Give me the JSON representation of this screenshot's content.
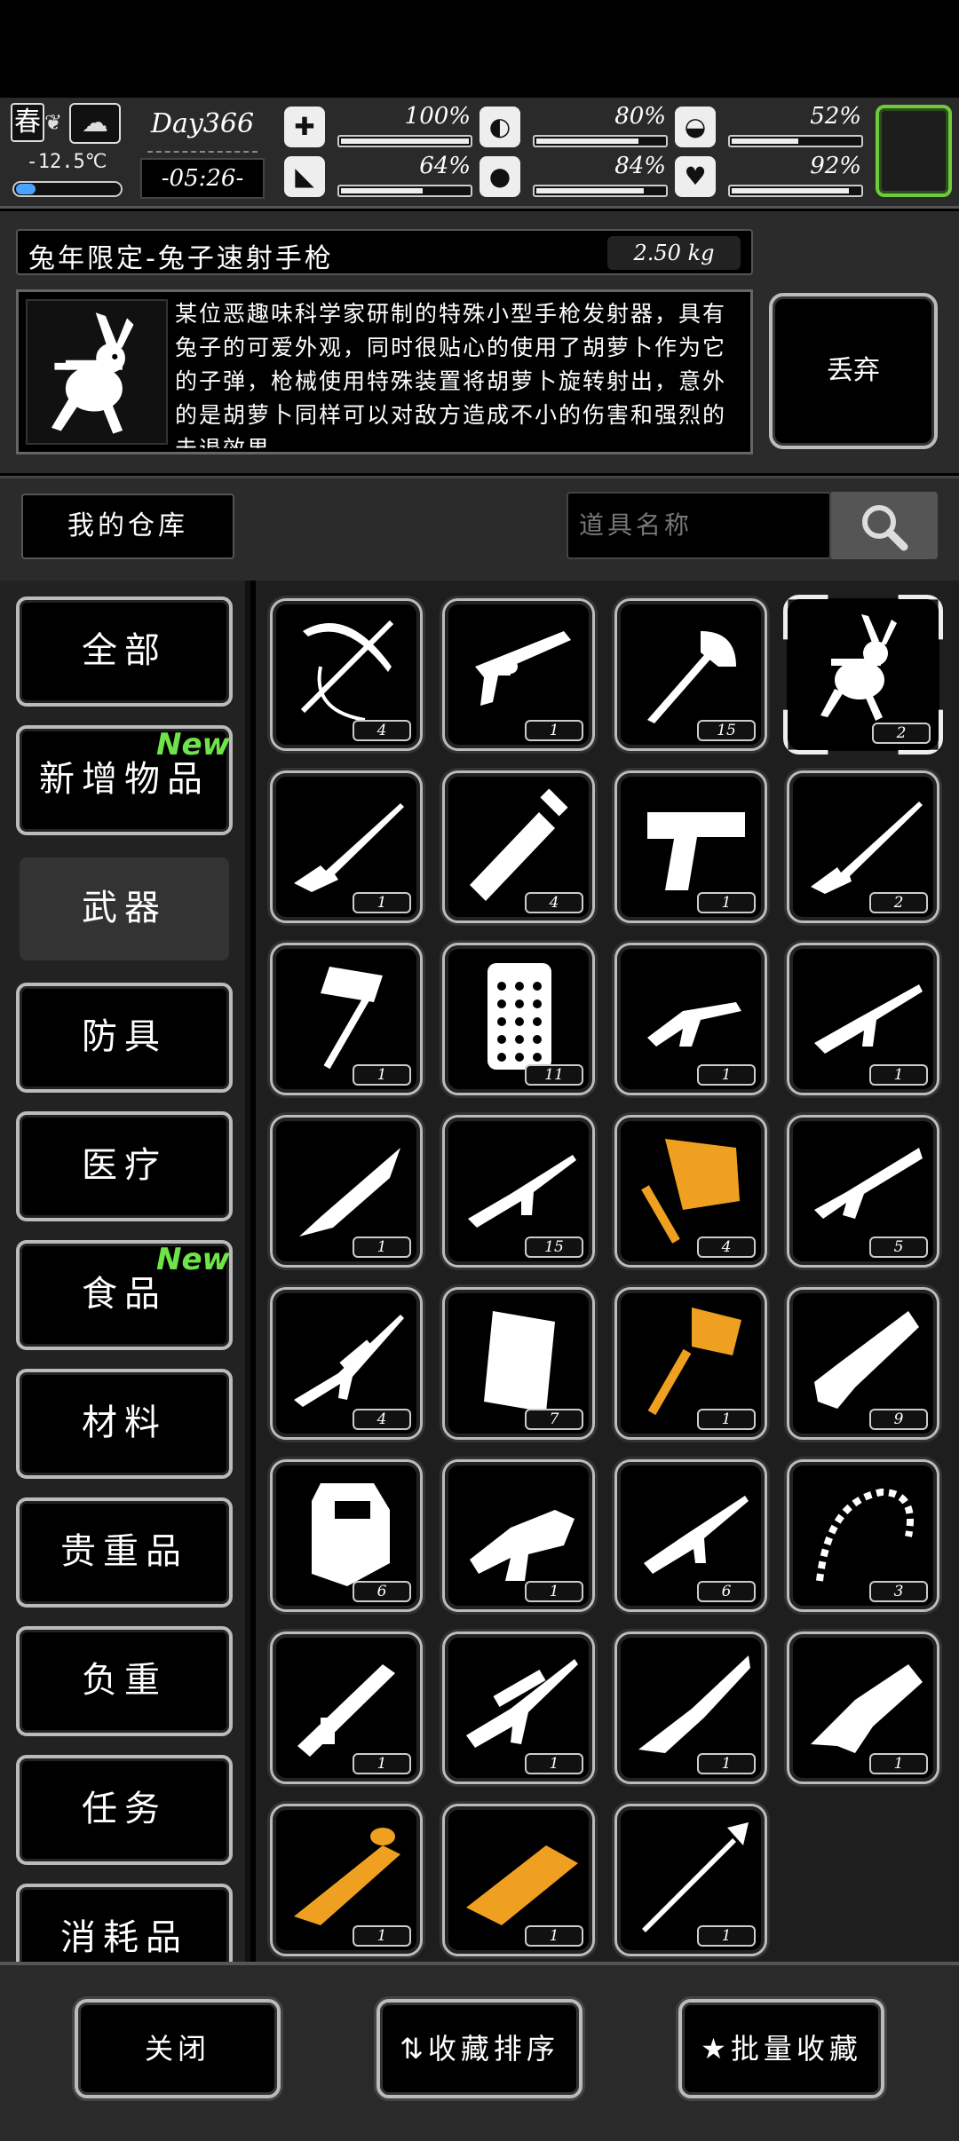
{
  "hud": {
    "season": "春",
    "temperature": "-12.5℃",
    "day": "Day366",
    "time": "-05:26-",
    "stats": [
      {
        "icon": "medkit-icon",
        "glyph": "✚",
        "value": "100%",
        "level": 1.0
      },
      {
        "icon": "stomach-icon",
        "glyph": "◐",
        "value": "80%",
        "level": 0.8
      },
      {
        "icon": "pill-icon",
        "glyph": "◒",
        "value": "52%",
        "level": 0.52
      },
      {
        "icon": "boot-icon",
        "glyph": "◣",
        "value": "64%",
        "level": 0.64
      },
      {
        "icon": "water-drop-icon",
        "glyph": "●",
        "value": "84%",
        "level": 0.84
      },
      {
        "icon": "heart-icon",
        "glyph": "♥",
        "value": "92%",
        "level": 0.92
      }
    ]
  },
  "detail": {
    "name": "兔年限定-兔子速射手枪",
    "weight": "2.50 kg",
    "description": "某位恶趣味科学家研制的特殊小型手枪发射器，具有兔子的可爱外观，同时很贴心的使用了胡萝卜作为它的子弹，枪械使用特殊装置将胡萝卜旋转射出，意外的是胡萝卜同样可以对敌方造成不小的伤害和强烈的击退效果。",
    "discard_label": "丢弃"
  },
  "storage": {
    "title": "我的仓库",
    "search_placeholder": "道具名称"
  },
  "nav": [
    {
      "label": "全部",
      "new": false,
      "active": false
    },
    {
      "label": "新增物品",
      "new": true,
      "active": false
    },
    {
      "label": "武器",
      "new": false,
      "active": true
    },
    {
      "label": "防具",
      "new": false,
      "active": false
    },
    {
      "label": "医疗",
      "new": false,
      "active": false
    },
    {
      "label": "食品",
      "new": true,
      "active": false
    },
    {
      "label": "材料",
      "new": false,
      "active": false
    },
    {
      "label": "贵重品",
      "new": false,
      "active": false
    },
    {
      "label": "负重",
      "new": false,
      "active": false
    },
    {
      "label": "任务",
      "new": false,
      "active": false
    },
    {
      "label": "消耗品",
      "new": false,
      "active": false
    }
  ],
  "new_badge": "New",
  "items": [
    {
      "icon": "crossbow-icon",
      "count": "4",
      "gold": false
    },
    {
      "icon": "revolver-icon",
      "count": "1",
      "gold": false
    },
    {
      "icon": "axe-icon",
      "count": "15",
      "gold": false
    },
    {
      "icon": "rabbit-pistol-icon",
      "count": "2",
      "gold": false,
      "selected": true
    },
    {
      "icon": "rifle-icon",
      "count": "1",
      "gold": false
    },
    {
      "icon": "blade-icon",
      "count": "4",
      "gold": false
    },
    {
      "icon": "desert-eagle-icon",
      "count": "1",
      "gold": false
    },
    {
      "icon": "hunting-rifle-icon",
      "count": "2",
      "gold": false
    },
    {
      "icon": "war-hammer-icon",
      "count": "1",
      "gold": false
    },
    {
      "icon": "riot-shield-studded-icon",
      "count": "11",
      "gold": false
    },
    {
      "icon": "smg-icon",
      "count": "1",
      "gold": false
    },
    {
      "icon": "assault-rifle-icon",
      "count": "1",
      "gold": false
    },
    {
      "icon": "combat-knife-icon",
      "count": "1",
      "gold": false
    },
    {
      "icon": "m16-icon",
      "count": "15",
      "gold": false
    },
    {
      "icon": "golden-hammer-icon",
      "count": "4",
      "gold": true
    },
    {
      "icon": "shotgun-icon",
      "count": "5",
      "gold": false
    },
    {
      "icon": "sniper-rifle-icon",
      "count": "4",
      "gold": false
    },
    {
      "icon": "armor-plate-icon",
      "count": "7",
      "gold": false
    },
    {
      "icon": "golden-mace-icon",
      "count": "1",
      "gold": true
    },
    {
      "icon": "chainsaw-icon",
      "count": "9",
      "gold": false
    },
    {
      "icon": "police-shield-icon",
      "count": "6",
      "gold": false
    },
    {
      "icon": "grenade-launcher-icon",
      "count": "1",
      "gold": false
    },
    {
      "icon": "ak-rifle-icon",
      "count": "6",
      "gold": false
    },
    {
      "icon": "chain-whip-icon",
      "count": "3",
      "gold": false
    },
    {
      "icon": "rocket-launcher-icon",
      "count": "1",
      "gold": false
    },
    {
      "icon": "heavy-sniper-icon",
      "count": "1",
      "gold": false
    },
    {
      "icon": "ornate-rifle-icon",
      "count": "1",
      "gold": false
    },
    {
      "icon": "dragon-gun-icon",
      "count": "1",
      "gold": false
    },
    {
      "icon": "rabbit-launcher-gold-icon",
      "count": "1",
      "gold": true
    },
    {
      "icon": "golden-cannon-icon",
      "count": "1",
      "gold": true
    },
    {
      "icon": "spear-icon",
      "count": "1",
      "gold": false
    }
  ],
  "bottom": {
    "close": "关闭",
    "sort": "收藏排序",
    "batch": "批量收藏"
  },
  "colors": {
    "accent_green": "#6ecb3b",
    "new_green": "#6ee34a",
    "gold": "#f0a020"
  }
}
